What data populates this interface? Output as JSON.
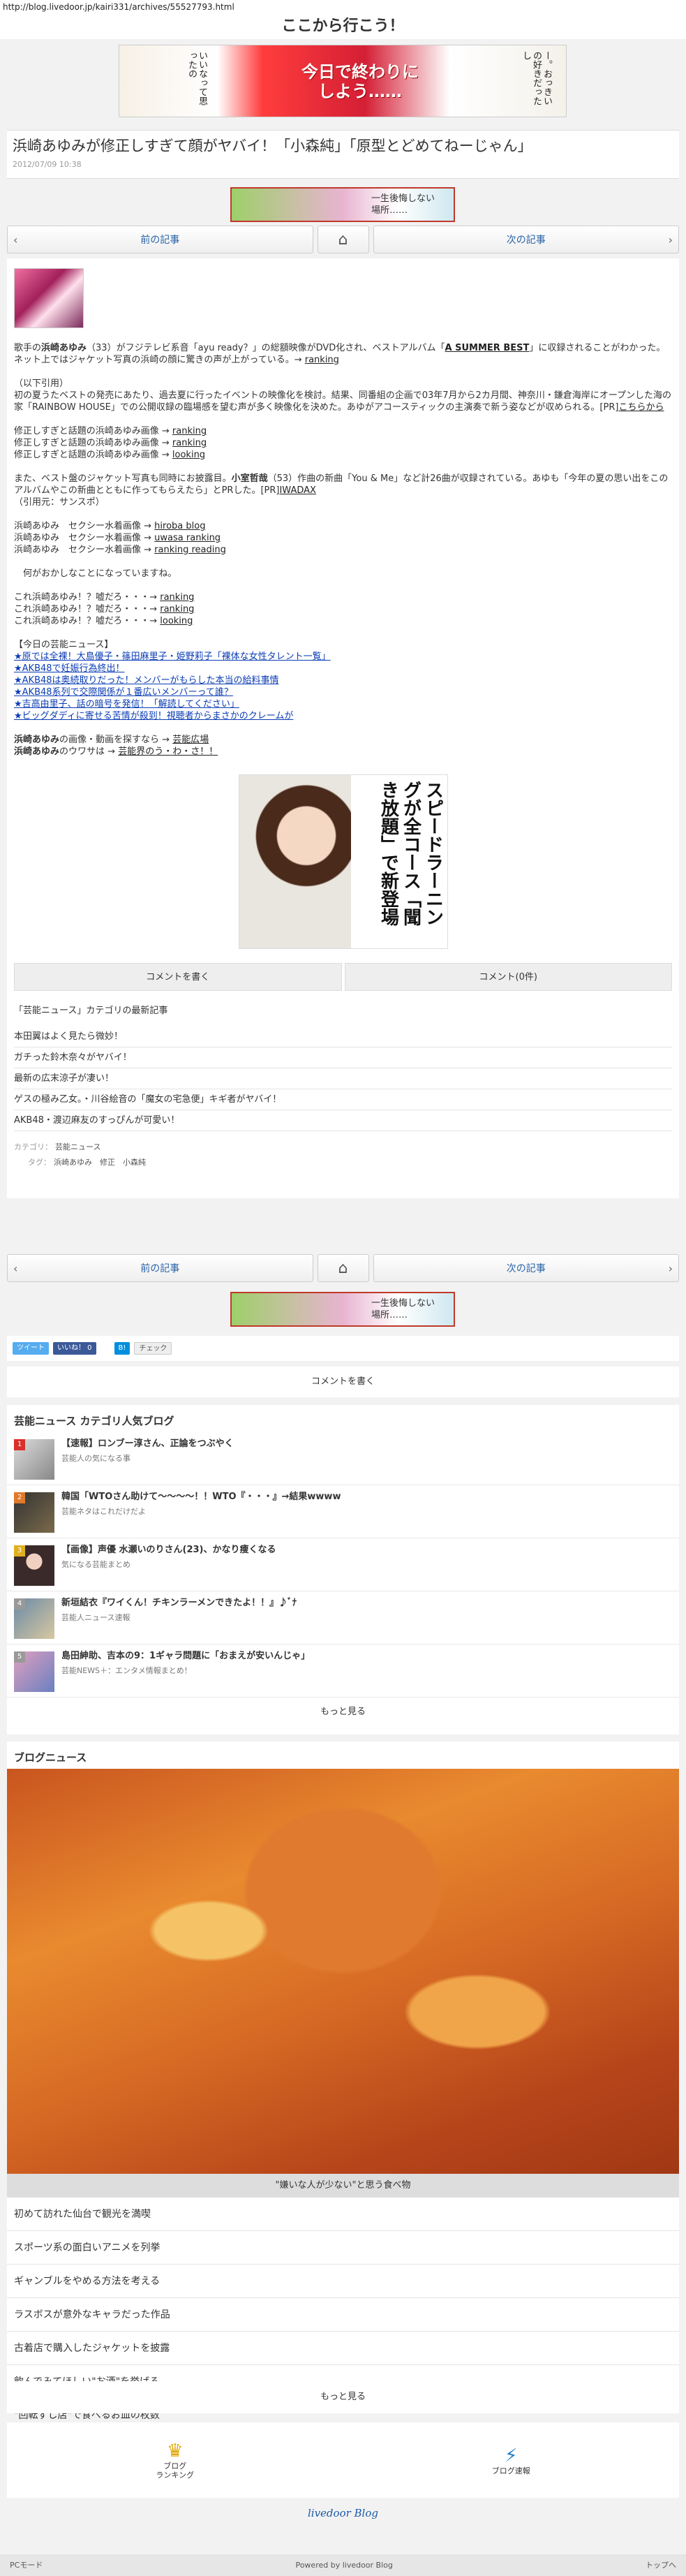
{
  "url": "http://blog.livedoor.jp/kairi331/archives/55527793.html",
  "site_title": "ここから行こう！",
  "banner_top": {
    "main": "今日で終わりに\nしよう……",
    "left": "いいなって思ったの",
    "right": "ー。おっきいの好きだったし"
  },
  "article": {
    "title": "浜崎あゆみが修正しすぎて顔がヤバイ！「小森純」「原型とどめてねーじゃん」",
    "date": "2012/07/09 10:38"
  },
  "ad_small": {
    "text": "一生後悔しない\n場所……"
  },
  "nav": {
    "prev": "前の記事",
    "next": "次の記事",
    "prev_arrow": "‹",
    "next_arrow": "›",
    "home_icon": "⌂"
  },
  "body": {
    "p1_pre": "歌手の",
    "p1_name": "浜崎あゆみ",
    "p1_text": "（33）がフジテレビ系音「ayu ready？」の総額映像がDVD化され、ベストアルバム「",
    "p1_album": "A SUMMER BEST",
    "p1_post": "」に収録されることがわかった。ネット上ではジャケット写真の浜崎の顔に驚きの声が上がっている。→ ",
    "p1_link": "ranking",
    "p2_l1": "（以下引用）",
    "p2_l2": "初の夏うたベストの発売にあたり、過去夏に行ったイベントの映像化を検討。結果、同番組の企画で03年7月から2カ月間、神奈川・鎌倉海岸にオープンした海の家「RAINBOW HOUSE」での公開収録の臨場感を望む声が多く映像化を決めた。あゆがアコースティックの主演奏で新う姿などが収められる。[PR]",
    "p2_link": "こちらから",
    "p3": [
      {
        "text": "修正しすぎと話題の浜崎あゆみ画像 → ",
        "link": "ranking"
      },
      {
        "text": "修正しすぎと話題の浜崎あゆみ画像 → ",
        "link": "ranking"
      },
      {
        "text": "修正しすぎと話題の浜崎あゆみ画像 → ",
        "link": "looking"
      }
    ],
    "p4_pre": "また、ベスト盤のジャケット写真も同時にお披露目。",
    "p4_name": "小室哲哉",
    "p4_text": "（53）作曲の新曲「You & Me」など計26曲が収録されている。あゆも「今年の夏の思い出をこのアルバムやこの新曲とともに作ってもらえたら」とPRした。[PR]",
    "p4_link": "IWADAX",
    "p4_src": "（引用元：サンスポ）",
    "p5": [
      {
        "text": "浜崎あゆみ　セクシー水着画像 → ",
        "link": "hiroba blog"
      },
      {
        "text": "浜崎あゆみ　セクシー水着画像 → ",
        "link": "uwasa ranking"
      },
      {
        "text": "浜崎あゆみ　セクシー水着画像 → ",
        "link": "ranking reading"
      }
    ],
    "p6": "　何がおかしなことになっていますね。",
    "p7": [
      {
        "text": "これ浜崎あゆみ！？嘘だろ・・・→ ",
        "link": "ranking"
      },
      {
        "text": "これ浜崎あゆみ！？嘘だろ・・・→ ",
        "link": "ranking"
      },
      {
        "text": "これ浜崎あゆみ！？嘘だろ・・・→ ",
        "link": "looking"
      }
    ],
    "hot_head": "【今日の芸能ニュース】",
    "hot": [
      "★原では全裸！大島優子・篠田麻里子・姫野莉子「裸体な女性タレント一覧」",
      "★AKB48で妊娠行為終出！",
      "★AKB48は奥続取りだった！メンバーがもらした本当の給料事情",
      "★AKB48系列で交際関係が１番広いメンバーって誰？",
      "★吉高由里子、話の暗号を発信！「解読してください」",
      "★ビッグダディに寄せる苦情が殺到！視聴者からまさかのクレームが"
    ],
    "p8": [
      {
        "pre": "浜崎あゆみ",
        "text": "の画像・動画を探すなら → ",
        "link": "芸能広場"
      },
      {
        "pre": "浜崎あゆみ",
        "text": "のウワサは → ",
        "link": "芸能界のう・わ・さ！！"
      }
    ]
  },
  "ad_photo": {
    "text": "スピードラーニングが全コース「聞き放題」で新登場"
  },
  "comment_buttons": {
    "write": "コメントを書く",
    "count": "コメント(0件)"
  },
  "category": {
    "heading": "「芸能ニュース」カテゴリの最新記事",
    "items": [
      "本田翼はよく見たら微妙！",
      "ガチった鈴木奈々がヤバイ！",
      "最新の広末涼子が凄い！",
      "ゲスの極み乙女。・川谷絵音の「魔女の宅急便」キギ者がヤバイ！",
      "AKB48・渡辺麻友のすっぴんが可愛い！"
    ],
    "cat_label": "カテゴリ：",
    "cat_value": "芸能ニュース",
    "tag_label": "タグ：",
    "tag_values": "浜崎あゆみ　修正　小森純"
  },
  "social": {
    "tweet": "ツイート",
    "like": "いいね！ 0",
    "hatena": "B!",
    "check": "チェック"
  },
  "comment_write": "コメントを書く",
  "popular": {
    "heading": "芸能ニュース カテゴリ人気ブログ",
    "items": [
      {
        "num": "1",
        "title": "【速報】ロンブー淳さん、正論をつぶやく",
        "src": "芸能人の気になる事"
      },
      {
        "num": "2",
        "title": "韓国「WTOさん助けて〜〜〜〜！！WTO『・・・』→結果wwww",
        "src": "芸能ネタはこれだけだよ"
      },
      {
        "num": "3",
        "title": "【画像】声優 水瀬いのりさん(23)、かなり痩くなる",
        "src": "気になる芸能まとめ"
      },
      {
        "num": "4",
        "title": "新垣結衣『ワイくん！チキンラーメンできたよ！！』♪ﾞﾅ",
        "src": "芸能人ニュース速報"
      },
      {
        "num": "5",
        "title": "島田紳助、吉本の9：1ギャラ問題に「おまえが安いんじゃ」",
        "src": "芸能NEWS＋：エンタメ情報まとめ！"
      }
    ],
    "more": "もっと見る"
  },
  "news": {
    "heading": "ブログニュース",
    "caption": "\"嫌いな人が少ない\"と思う食べ物",
    "items": [
      "初めて訪れた仙台で観光を満喫",
      "スポーツ系の面白いアニメを列挙",
      "ギャンブルをやめる方法を考える",
      "ラスボスが意外なキャラだった作品",
      "古着店で購入したジャケットを披露",
      "飲んでみてほしい\"お酒\"を挙げる",
      "\"回転ずし店\"で食べるお皿の枚数"
    ],
    "more": "もっと見る"
  },
  "footer": {
    "rank": "ブログ\nランキング",
    "rank_icon": "♛",
    "news": "ブログ速報",
    "news_icon": "⚡",
    "logo": "livedoor Blog",
    "powered": "Powered by livedoor Blog",
    "pc": "PCモード",
    "top": "トップへ"
  },
  "colors": {
    "link_blue": "#2864a8",
    "hot_blue": "#0a3cb4",
    "twitter": "#55acee",
    "facebook": "#3b5998"
  }
}
